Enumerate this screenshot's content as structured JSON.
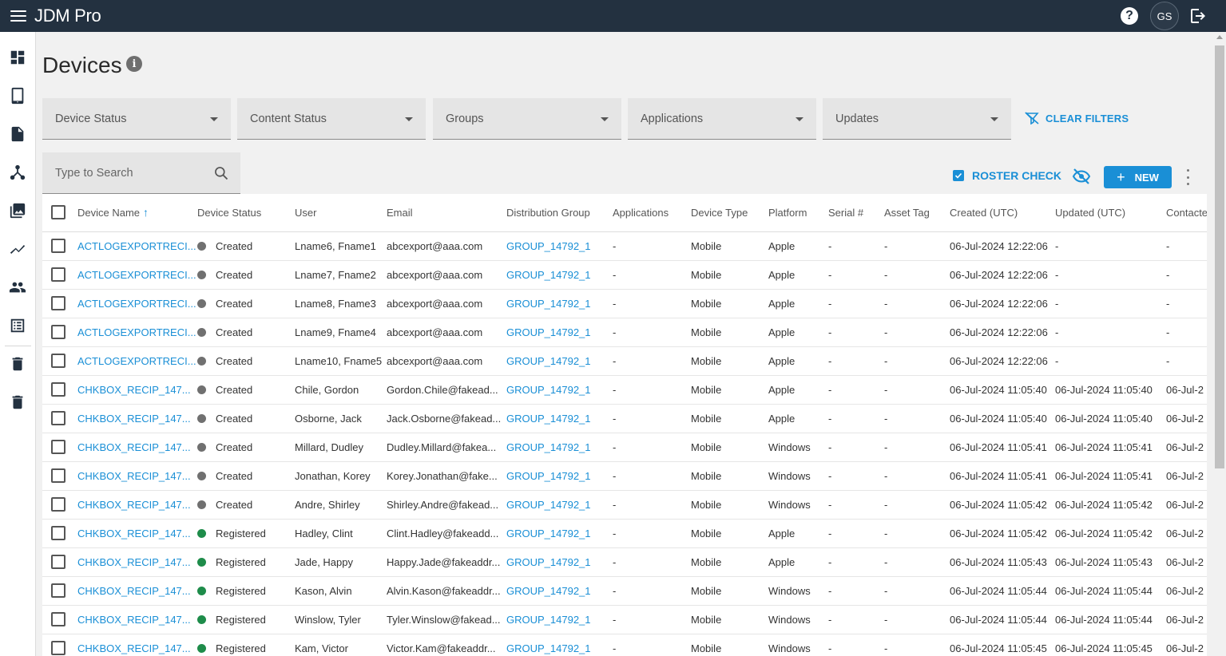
{
  "app": {
    "title": "JDM Pro",
    "user_initials": "GS"
  },
  "page": {
    "title": "Devices"
  },
  "filters": [
    {
      "label": "Device Status"
    },
    {
      "label": "Content Status"
    },
    {
      "label": "Groups"
    },
    {
      "label": "Applications"
    },
    {
      "label": "Updates"
    }
  ],
  "clear_filters_label": "CLEAR FILTERS",
  "search": {
    "placeholder": "Type to Search"
  },
  "toolbar": {
    "roster_check_label": "ROSTER CHECK",
    "new_label": "NEW"
  },
  "colors": {
    "accent": "#1a8fd6",
    "topbar": "#233140",
    "status_created": "#707070",
    "status_registered": "#1e8c4a"
  },
  "nav_icons": [
    "dashboard-icon",
    "tablet-icon",
    "document-icon",
    "hierarchy-icon",
    "image-gallery-icon",
    "trend-chart-icon",
    "users-icon",
    "list-icon",
    "trash-icon",
    "trash-alt-icon"
  ],
  "table": {
    "columns": [
      "Device Name",
      "Device Status",
      "User",
      "Email",
      "Distribution Group",
      "Applications",
      "Device Type",
      "Platform",
      "Serial #",
      "Asset Tag",
      "Created (UTC)",
      "Updated (UTC)",
      "Contacted"
    ],
    "rows": [
      {
        "name": "ACTLOGEXPORTRECI...",
        "status": "Created",
        "user": "Lname6, Fname1",
        "email": "abcexport@aaa.com",
        "group": "GROUP_14792_1",
        "apps": "-",
        "type": "Mobile",
        "platform": "Apple",
        "serial": "-",
        "asset": "-",
        "created": "06-Jul-2024 12:22:06",
        "updated": "-",
        "contacted": "-"
      },
      {
        "name": "ACTLOGEXPORTRECI...",
        "status": "Created",
        "user": "Lname7, Fname2",
        "email": "abcexport@aaa.com",
        "group": "GROUP_14792_1",
        "apps": "-",
        "type": "Mobile",
        "platform": "Apple",
        "serial": "-",
        "asset": "-",
        "created": "06-Jul-2024 12:22:06",
        "updated": "-",
        "contacted": "-"
      },
      {
        "name": "ACTLOGEXPORTRECI...",
        "status": "Created",
        "user": "Lname8, Fname3",
        "email": "abcexport@aaa.com",
        "group": "GROUP_14792_1",
        "apps": "-",
        "type": "Mobile",
        "platform": "Apple",
        "serial": "-",
        "asset": "-",
        "created": "06-Jul-2024 12:22:06",
        "updated": "-",
        "contacted": "-"
      },
      {
        "name": "ACTLOGEXPORTRECI...",
        "status": "Created",
        "user": "Lname9, Fname4",
        "email": "abcexport@aaa.com",
        "group": "GROUP_14792_1",
        "apps": "-",
        "type": "Mobile",
        "platform": "Apple",
        "serial": "-",
        "asset": "-",
        "created": "06-Jul-2024 12:22:06",
        "updated": "-",
        "contacted": "-"
      },
      {
        "name": "ACTLOGEXPORTRECI...",
        "status": "Created",
        "user": "Lname10, Fname5",
        "email": "abcexport@aaa.com",
        "group": "GROUP_14792_1",
        "apps": "-",
        "type": "Mobile",
        "platform": "Apple",
        "serial": "-",
        "asset": "-",
        "created": "06-Jul-2024 12:22:06",
        "updated": "-",
        "contacted": "-"
      },
      {
        "name": "CHKBOX_RECIP_147...",
        "status": "Created",
        "user": "Chile, Gordon",
        "email": "Gordon.Chile@fakead...",
        "group": "GROUP_14792_1",
        "apps": "-",
        "type": "Mobile",
        "platform": "Apple",
        "serial": "-",
        "asset": "-",
        "created": "06-Jul-2024 11:05:40",
        "updated": "06-Jul-2024 11:05:40",
        "contacted": "06-Jul-2"
      },
      {
        "name": "CHKBOX_RECIP_147...",
        "status": "Created",
        "user": "Osborne, Jack",
        "email": "Jack.Osborne@fakead...",
        "group": "GROUP_14792_1",
        "apps": "-",
        "type": "Mobile",
        "platform": "Apple",
        "serial": "-",
        "asset": "-",
        "created": "06-Jul-2024 11:05:40",
        "updated": "06-Jul-2024 11:05:40",
        "contacted": "06-Jul-2"
      },
      {
        "name": "CHKBOX_RECIP_147...",
        "status": "Created",
        "user": "Millard, Dudley",
        "email": "Dudley.Millard@fakea...",
        "group": "GROUP_14792_1",
        "apps": "-",
        "type": "Mobile",
        "platform": "Windows",
        "serial": "-",
        "asset": "-",
        "created": "06-Jul-2024 11:05:41",
        "updated": "06-Jul-2024 11:05:41",
        "contacted": "06-Jul-2"
      },
      {
        "name": "CHKBOX_RECIP_147...",
        "status": "Created",
        "user": "Jonathan, Korey",
        "email": "Korey.Jonathan@fake...",
        "group": "GROUP_14792_1",
        "apps": "-",
        "type": "Mobile",
        "platform": "Windows",
        "serial": "-",
        "asset": "-",
        "created": "06-Jul-2024 11:05:41",
        "updated": "06-Jul-2024 11:05:41",
        "contacted": "06-Jul-2"
      },
      {
        "name": "CHKBOX_RECIP_147...",
        "status": "Created",
        "user": "Andre, Shirley",
        "email": "Shirley.Andre@fakead...",
        "group": "GROUP_14792_1",
        "apps": "-",
        "type": "Mobile",
        "platform": "Windows",
        "serial": "-",
        "asset": "-",
        "created": "06-Jul-2024 11:05:42",
        "updated": "06-Jul-2024 11:05:42",
        "contacted": "06-Jul-2"
      },
      {
        "name": "CHKBOX_RECIP_147...",
        "status": "Registered",
        "user": "Hadley, Clint",
        "email": "Clint.Hadley@fakeadd...",
        "group": "GROUP_14792_1",
        "apps": "-",
        "type": "Mobile",
        "platform": "Apple",
        "serial": "-",
        "asset": "-",
        "created": "06-Jul-2024 11:05:42",
        "updated": "06-Jul-2024 11:05:42",
        "contacted": "06-Jul-2"
      },
      {
        "name": "CHKBOX_RECIP_147...",
        "status": "Registered",
        "user": "Jade, Happy",
        "email": "Happy.Jade@fakeaddr...",
        "group": "GROUP_14792_1",
        "apps": "-",
        "type": "Mobile",
        "platform": "Apple",
        "serial": "-",
        "asset": "-",
        "created": "06-Jul-2024 11:05:43",
        "updated": "06-Jul-2024 11:05:43",
        "contacted": "06-Jul-2"
      },
      {
        "name": "CHKBOX_RECIP_147...",
        "status": "Registered",
        "user": "Kason, Alvin",
        "email": "Alvin.Kason@fakeaddr...",
        "group": "GROUP_14792_1",
        "apps": "-",
        "type": "Mobile",
        "platform": "Windows",
        "serial": "-",
        "asset": "-",
        "created": "06-Jul-2024 11:05:44",
        "updated": "06-Jul-2024 11:05:44",
        "contacted": "06-Jul-2"
      },
      {
        "name": "CHKBOX_RECIP_147...",
        "status": "Registered",
        "user": "Winslow, Tyler",
        "email": "Tyler.Winslow@fakead...",
        "group": "GROUP_14792_1",
        "apps": "-",
        "type": "Mobile",
        "platform": "Windows",
        "serial": "-",
        "asset": "-",
        "created": "06-Jul-2024 11:05:44",
        "updated": "06-Jul-2024 11:05:44",
        "contacted": "06-Jul-2"
      },
      {
        "name": "CHKBOX_RECIP_147...",
        "status": "Registered",
        "user": "Kam, Victor",
        "email": "Victor.Kam@fakeaddr...",
        "group": "GROUP_14792_1",
        "apps": "-",
        "type": "Mobile",
        "platform": "Windows",
        "serial": "-",
        "asset": "-",
        "created": "06-Jul-2024 11:05:45",
        "updated": "06-Jul-2024 11:05:45",
        "contacted": "06-Jul-2"
      }
    ]
  }
}
